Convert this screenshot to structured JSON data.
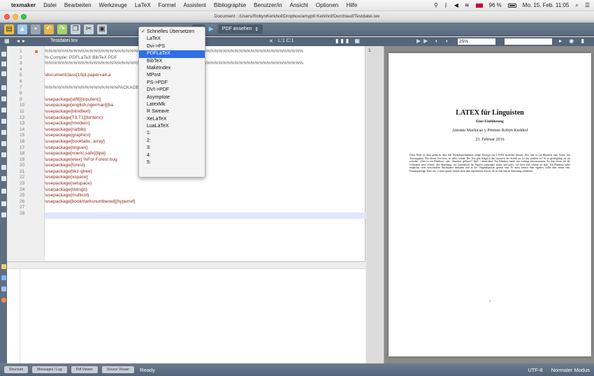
{
  "menubar": {
    "app": "texmaker",
    "items": [
      "Datei",
      "Bearbeiten",
      "Werkzeuge",
      "LaTeX",
      "Formel",
      "Assistent",
      "Bibliographie",
      "Benutzer/in",
      "Ansicht",
      "Optionen",
      "Hilfe"
    ],
    "battery": "96 %",
    "clock": "Mo. 15. Feb. 11:05"
  },
  "window": {
    "title": "Document : /Users/RobynKerkhof/Dropbox/amyp8 Kerkhof/Durchlauf/Testdatei.tex"
  },
  "toolbar": {
    "quick_build_selected": "Schnelles Übersetzen",
    "view_pdf": "PDF ansehen"
  },
  "subbar": {
    "filename": "Testdatei.tex",
    "line_col": "L:1 C:1",
    "pdf_zoom": "25%",
    "pdf_page": "1"
  },
  "dropdown": {
    "items": [
      {
        "label": "Schnelles Übersetzen",
        "checked": true
      },
      {
        "label": "LaTeX"
      },
      {
        "label": "Dvi->PS"
      },
      {
        "label": "PDFLaTeX",
        "highlighted": true
      },
      {
        "label": "BibTeX"
      },
      {
        "label": "MakeIndex"
      },
      {
        "label": "MPost"
      },
      {
        "label": "PS->PDF"
      },
      {
        "label": "DVI->PDF"
      },
      {
        "label": "Asymptote"
      },
      {
        "label": "LatexMk"
      },
      {
        "label": "R Sweave"
      },
      {
        "label": "XeLaTeX"
      },
      {
        "label": "LuaLaTeX"
      },
      {
        "label": "1:"
      },
      {
        "label": "2:"
      },
      {
        "label": "3:"
      },
      {
        "label": "4:"
      },
      {
        "label": "5:"
      }
    ]
  },
  "editor": {
    "lines": [
      {
        "n": "1",
        "t": "%%%%%%%%%%%%%%%%%%%%%%%%%%%%%%%%%%%%%%%%%%%%%%%%%%%%%%%%%%%%%%%%",
        "cls": "cm"
      },
      {
        "n": "2",
        "t": "% Compile: PDFLaTeX BibTeX PDF",
        "cls": "cm"
      },
      {
        "n": "3",
        "t": "%%%%%%%%%%%%%%%%%%%%%%%%%%%%%%%%%%%%%%%%%%%%%%%%%%%%%%%%%%%%%%%%",
        "cls": "cm"
      },
      {
        "n": "4",
        "t": "",
        "cls": ""
      },
      {
        "n": "5",
        "t": "\\documentclass[10pt,paper=a4,a",
        "cls": "cmd"
      },
      {
        "n": "6",
        "t": "",
        "cls": ""
      },
      {
        "n": "7",
        "t": "%%%%%%%%%%%%%%%%%%PACKAGE",
        "cls": "cm"
      },
      {
        "n": "8",
        "t": "",
        "cls": ""
      },
      {
        "n": "9",
        "t": "\\usepackage[utf8]{inputenc}",
        "cls": "cmd"
      },
      {
        "n": "10",
        "t": "\\usepackage[english,ngerman]{ba",
        "cls": "cmd"
      },
      {
        "n": "11",
        "t": "\\usepackage{blindtext}",
        "cls": "cmd"
      },
      {
        "n": "12",
        "t": "\\usepackage[T3,T1]{fontenc}",
        "cls": "cmd"
      },
      {
        "n": "13",
        "t": "\\usepackage{lmodern}",
        "cls": "cmd"
      },
      {
        "n": "14",
        "t": "\\usepackage{natbib}",
        "cls": "cmd"
      },
      {
        "n": "15",
        "t": "\\usepackage{graphicx}",
        "cls": "cmd"
      },
      {
        "n": "16",
        "t": "\\usepackage{booktabs, array}",
        "cls": "cmd"
      },
      {
        "n": "17",
        "t": "\\usepackage{linguex}",
        "cls": "cmd"
      },
      {
        "n": "18",
        "t": "\\usepackage[noenc,safe]{tipa}",
        "cls": "cmd"
      },
      {
        "n": "19",
        "t": "\\usepackage{etex}     %For Forest bug",
        "cls": "cmd"
      },
      {
        "n": "20",
        "t": "\\usepackage{forest}",
        "cls": "cmd"
      },
      {
        "n": "21",
        "t": "\\usepackage{tikz-qtree}",
        "cls": "cmd"
      },
      {
        "n": "22",
        "t": "\\usepackage{xspace}",
        "cls": "cmd"
      },
      {
        "n": "23",
        "t": "\\usepackage{setspace}",
        "cls": "cmd"
      },
      {
        "n": "24",
        "t": "\\usepackage{listings}",
        "cls": "cmd"
      },
      {
        "n": "25",
        "t": "\\usepackage{multicol}",
        "cls": "cmd"
      },
      {
        "n": "26",
        "t": "\\usepackage[bookmarksnumbered]{hyperref}",
        "cls": "cmd"
      },
      {
        "n": "27",
        "t": "",
        "cls": ""
      },
      {
        "n": "28",
        "t": "",
        "cls": ""
      }
    ]
  },
  "pdf": {
    "title": "LATEX für Linguisten",
    "subtitle": "Eine Einführung",
    "authors": "Antonio Machicao y Priemer     Robyn Kerkhof",
    "date": "23. Februar 2016",
    "abstract": "Diese Datei ist dazu gemacht, dass alle Workshopteilnehmer einige Vorzüge von LATEX austesten können. Dies hier ist ein Blindtext zum Testen von Textausgaben. Wer diesen Text liest, ist selbst schuld. Der Text gibt lediglich den Grauwert der Schrift an. Ist das wirklich so? Ist es gleichgültig, ob ich schreibe: „Dies ist ein Blindtext“ oder „Huardest gefburn“? Kjift – mitnichten! Ein Blindtext bietet mir wichtige Informationen. An ihm messe ich die Lesbarkeit einer Schrift, ihre Anmutung, wie harmonisch die Figuren zueinander stehen und prüfe, wie breit oder schmal sie läuft. Ein Blindtext sollte möglichst viele verschiedene Buchstaben enthalten und in der Originalsprache gesetzt sein. Er muss keinen Sinn ergeben, sollte aber lesbar sein. Fremdsprachige Texte wie „Lorem ipsum“ dienen nicht dem eigentlichen Zweck, da sie eine falsche Anmutung vermitteln.",
    "page_number": "1"
  },
  "statusbar": {
    "tabs": [
      "Structure",
      "Messages / Log",
      "Pdf Viewer",
      "Source Viewer"
    ],
    "status": "Ready",
    "encoding": "UTF-8",
    "mode": "Normaler Modus"
  }
}
